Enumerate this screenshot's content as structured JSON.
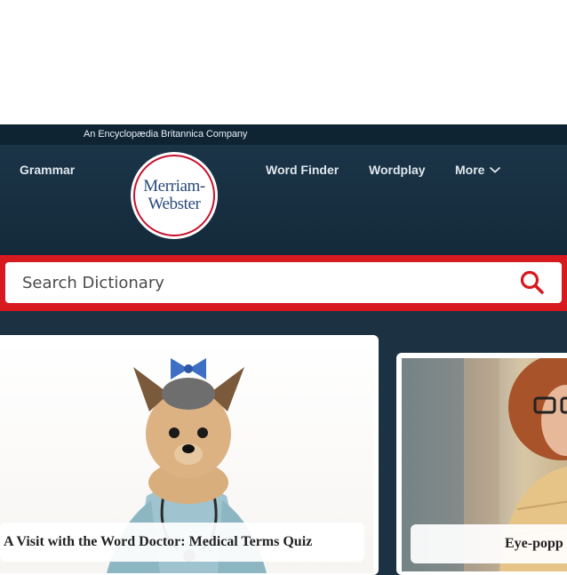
{
  "header": {
    "tagline": "An Encyclopædia Britannica Company",
    "nav_left": "Grammar",
    "logo": {
      "line1": "Merriam-",
      "line2": "Webster"
    },
    "nav_right": [
      "Word Finder",
      "Wordplay",
      "More"
    ],
    "more_icon": "chevron-down-icon"
  },
  "search": {
    "placeholder": "Search Dictionary",
    "icon": "search-icon"
  },
  "cards": [
    {
      "caption": "A Visit with the Word Doctor: Medical Terms Quiz",
      "image": "yorkshire terrier in doctor scrubs"
    },
    {
      "caption": "Eye-popp",
      "image": "woman with glasses reading"
    }
  ],
  "colors": {
    "brand_red": "#d71920",
    "header_navy": "#1c3142",
    "topbar_navy": "#0f2433",
    "logo_blue": "#2a4a7a"
  }
}
